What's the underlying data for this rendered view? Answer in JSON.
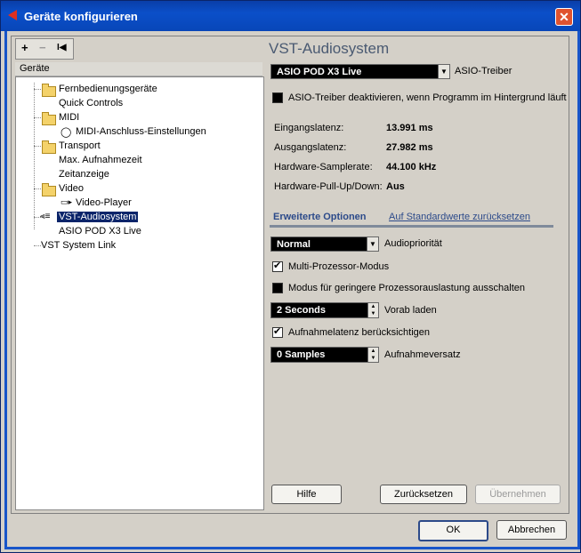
{
  "window": {
    "title": "Geräte konfigurieren"
  },
  "toolbar": {
    "add": "+",
    "remove": "−",
    "reset": "I◀"
  },
  "tree": {
    "header": "Geräte",
    "items": [
      {
        "label": "Fernbedienungsgeräte"
      },
      {
        "label": "Quick Controls"
      },
      {
        "label": "MIDI"
      },
      {
        "label": "MIDI-Anschluss-Einstellungen"
      },
      {
        "label": "Transport"
      },
      {
        "label": "Max. Aufnahmezeit"
      },
      {
        "label": "Zeitanzeige"
      },
      {
        "label": "Video"
      },
      {
        "label": "Video-Player"
      },
      {
        "label": "VST-Audiosystem"
      },
      {
        "label": "ASIO POD X3 Live"
      },
      {
        "label": "VST System Link"
      }
    ]
  },
  "panel": {
    "title": "VST-Audiosystem",
    "driver_value": "ASIO POD X3 Live",
    "driver_label": "ASIO-Treiber",
    "deactivate_label": "ASIO-Treiber deaktivieren, wenn Programm im Hintergrund läuft",
    "input_latency_label": "Eingangslatenz:",
    "input_latency_value": "13.991 ms",
    "output_latency_label": "Ausgangslatenz:",
    "output_latency_value": "27.982 ms",
    "samplerate_label": "Hardware-Samplerate:",
    "samplerate_value": "44.100 kHz",
    "pullup_label": "Hardware-Pull-Up/Down:",
    "pullup_value": "Aus",
    "advanced_label": "Erweiterte Optionen",
    "defaults_link": "Auf Standardwerte zurücksetzen",
    "priority_value": "Normal",
    "priority_label": "Audiopriorität",
    "multiproc_label": "Multi-Prozessor-Modus",
    "lowload_label": "Modus für geringere Prozessorauslastung ausschalten",
    "preload_value": "2 Seconds",
    "preload_label": "Vorab laden",
    "reclatency_label": "Aufnahmelatenz berücksichtigen",
    "recoffset_value": "0 Samples",
    "recoffset_label": "Aufnahmeversatz",
    "help_button": "Hilfe",
    "reset_button": "Zurücksetzen",
    "apply_button": "Übernehmen"
  },
  "footer": {
    "ok_button": "OK",
    "cancel_button": "Abbrechen"
  }
}
